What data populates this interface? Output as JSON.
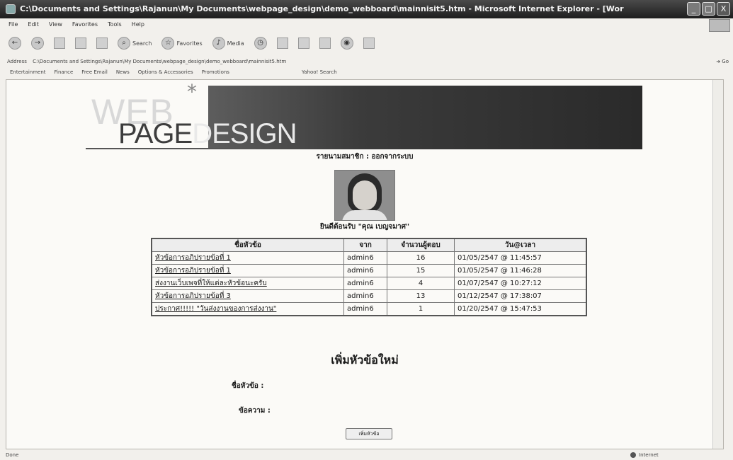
{
  "window": {
    "title": "C:\\Documents and Settings\\Rajanun\\My Documents\\webpage_design\\demo_webboard\\mainnisit5.htm - Microsoft Internet Explorer - [Wor",
    "controls": {
      "minimize": "_",
      "maximize": "□",
      "close": "X"
    }
  },
  "menu": [
    "File",
    "Edit",
    "View",
    "Favorites",
    "Tools",
    "Help"
  ],
  "toolbar": {
    "back": "Back",
    "forward": "Forward",
    "stop": "Stop",
    "refresh": "Refresh",
    "home": "Home",
    "search": "Search",
    "favorites": "Favorites",
    "media": "Media"
  },
  "address": {
    "label": "Address",
    "value": "C:\\Documents and Settings\\Rajanun\\My Documents\\webpage_design\\demo_webboard\\mainnisit5.htm",
    "go": "Go"
  },
  "links": [
    "Entertainment",
    "Finance",
    "Free Email",
    "News",
    "Options & Accessories",
    "Promotions",
    "Yahoo! Search"
  ],
  "page": {
    "banner": {
      "web": "WEB",
      "star": "*",
      "page": "PAGE",
      "design": "DESIGN"
    },
    "member_line": "รายนามสมาชิก : ออกจากระบบ",
    "welcome": "ยินดีต้อนรับ \"คุณ เบญจมาศ\"",
    "table": {
      "headers": [
        "ชื่อหัวข้อ",
        "จาก",
        "จำนวนผู้ตอบ",
        "วัน@เวลา"
      ],
      "rows": [
        [
          "หัวข้อการอภิปรายข้อที่ 1",
          "admin6",
          "16",
          "01/05/2547 @ 11:45:57"
        ],
        [
          "หัวข้อการอภิปรายข้อที่ 1",
          "admin6",
          "15",
          "01/05/2547 @ 11:46:28"
        ],
        [
          "ส่งงานเว็บเพจที่ให้แต่ละหัวข้อนะครับ",
          "admin6",
          "4",
          "01/07/2547 @ 10:27:12"
        ],
        [
          "หัวข้อการอภิปรายข้อที่ 3",
          "admin6",
          "13",
          "01/12/2547 @ 17:38:07"
        ],
        [
          "ประกาศ!!!!! \"วันส่งงานของการส่งงาน\"",
          "admin6",
          "1",
          "01/20/2547 @ 15:47:53"
        ]
      ]
    },
    "new_topic": {
      "title": "เพิ่มหัวข้อใหม่",
      "subject_label": "ชื่อหัวข้อ :",
      "message_label": "ข้อความ :",
      "submit": "เพิ่มหัวข้อ"
    }
  },
  "status": {
    "left": "Done",
    "right": "Internet"
  }
}
